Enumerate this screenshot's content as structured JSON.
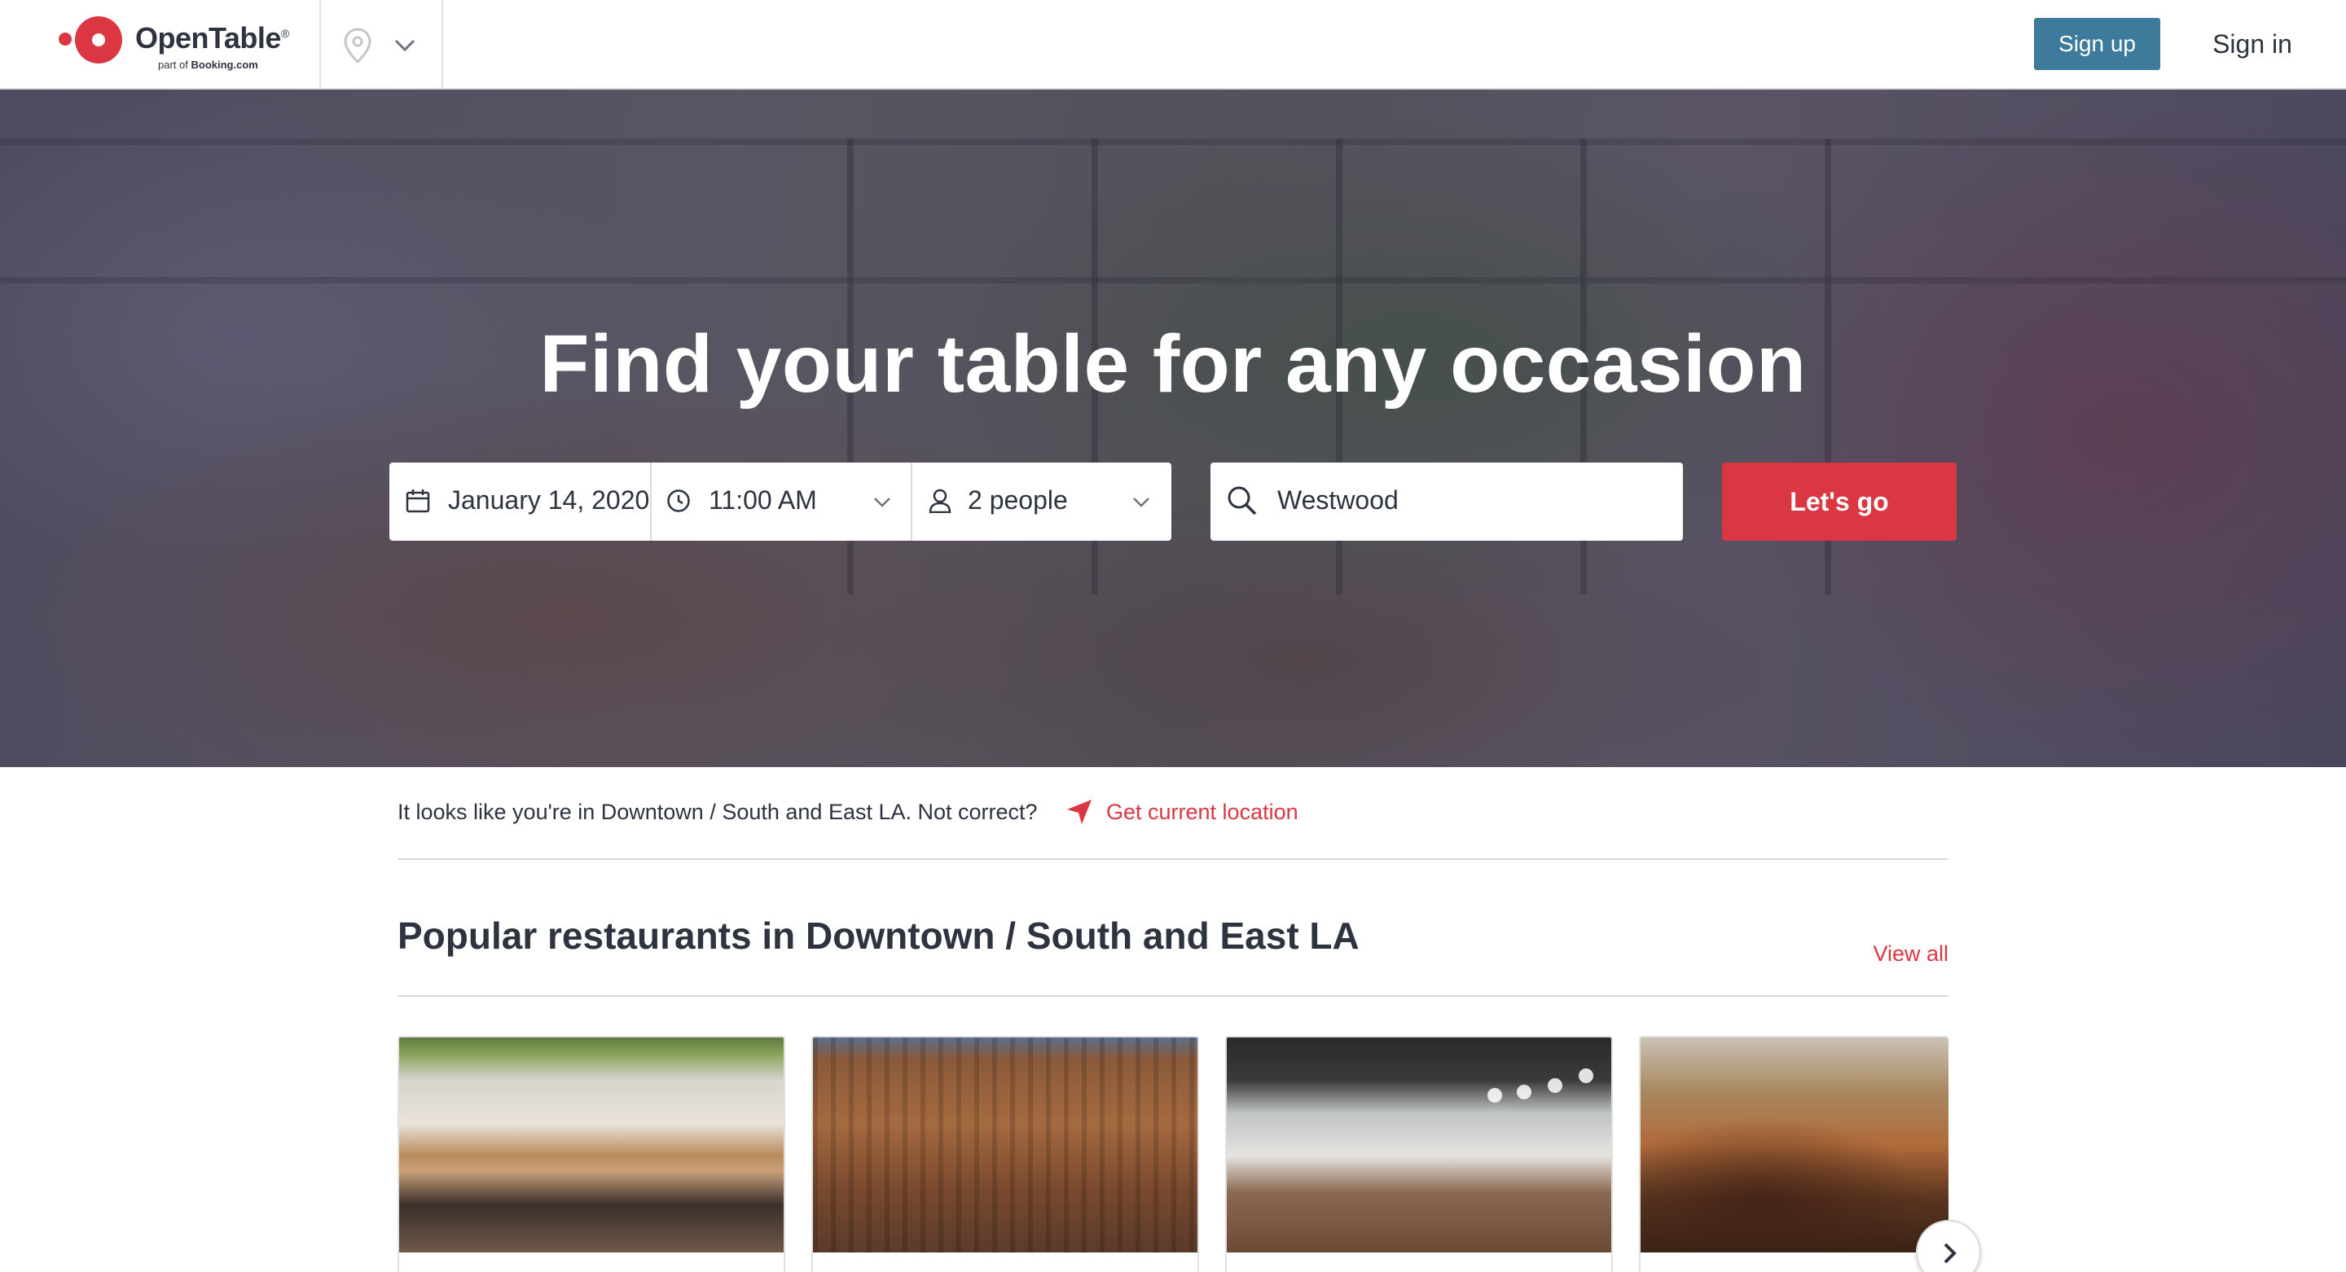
{
  "header": {
    "brand": "OpenTable",
    "brand_registered": "®",
    "brand_sub_prefix": "part of",
    "brand_sub_company": "Booking.com",
    "location_icon": "map-pin-icon",
    "signup_label": "Sign up",
    "signin_label": "Sign in",
    "signup_color": "#3d7a9b"
  },
  "hero": {
    "title": "Find your table for any occasion",
    "date": "January 14, 2020",
    "time": "11:00 AM",
    "party": "2 people",
    "location_value": "Westwood",
    "submit_label": "Let's go",
    "submit_color": "#da3743"
  },
  "location_notice": {
    "message": "It looks like you're in Downtown / South and East LA. Not correct?",
    "link": "Get current location",
    "icon": "navigation-arrow-icon"
  },
  "popular": {
    "title": "Popular restaurants in Downtown / South and East LA",
    "view_all": "View all",
    "next_icon": "chevron-right-icon",
    "cards": [
      {
        "id": 1
      },
      {
        "id": 2
      },
      {
        "id": 3
      },
      {
        "id": 4
      }
    ]
  },
  "colors": {
    "accent_red": "#da3743",
    "text_dark": "#2d333f",
    "divider": "#d8d9db"
  }
}
